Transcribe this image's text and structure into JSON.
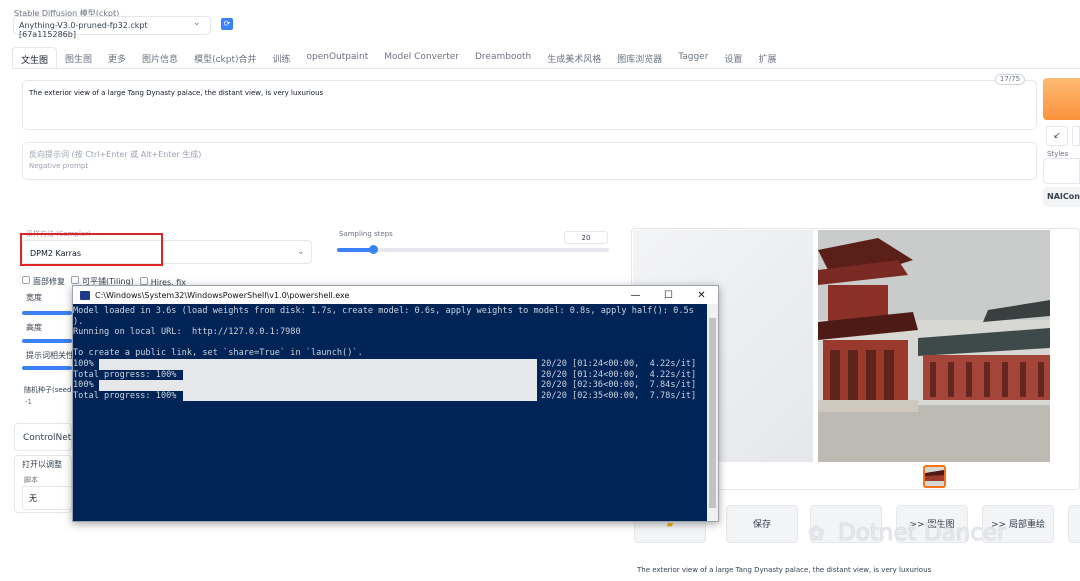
{
  "checkpoint": {
    "label": "Stable Diffusion 模型(ckpt)",
    "value": "Anything-V3.0-pruned-fp32.ckpt [67a115286b]",
    "refresh_icon": "refresh-icon"
  },
  "tabs": [
    "文生图",
    "图生图",
    "更多",
    "图片信息",
    "模型(ckpt)合并",
    "训练",
    "openOutpaint",
    "Model Converter",
    "Dreambooth",
    "生成美术风格",
    "图库浏览器",
    "Tagger",
    "设置",
    "扩展"
  ],
  "prompt": {
    "text": "The exterior view of a large Tang Dynasty palace, the distant view, is very luxurious",
    "counter": "17/75"
  },
  "negative_prompt": {
    "label": "反向提示词 (按 Ctrl+Enter 或 Alt+Enter 生成)",
    "placeholder": "Negative prompt"
  },
  "right_panel": {
    "styles_label": "Styles",
    "tool_glyph": "↙",
    "nai_label": "NAIConv"
  },
  "sampler": {
    "label": "采样方法 (Sampler)",
    "value": "DPM2 Karras"
  },
  "steps": {
    "label": "Sampling steps",
    "value": "20",
    "fraction": 0.133
  },
  "checkboxes": [
    "面部修复",
    "可平铺(Tiling)",
    "Hires. fix"
  ],
  "left_labels": {
    "width": "宽度",
    "height": "高度",
    "prompt_rel": "提示词相关性",
    "seed": "随机种子(seed)",
    "seed_value": "-1",
    "controlnet": "ControlNet",
    "open_adjust": "打开以调整",
    "script": "脚本",
    "script_value": "无"
  },
  "terminal": {
    "title": "C:\\Windows\\System32\\WindowsPowerShell\\v1.0\\powershell.exe",
    "lines": [
      "Model loaded in 3.6s (load weights from disk: 1.7s, create model: 0.6s, apply weights to model: 0.8s, apply half(): 0.5s",
      ").",
      "Running on local URL:  http://127.0.0.1:7980",
      "",
      "To create a public link, set `share=True` in `launch()`.",
      "100%",
      "Total progress: 100%",
      "100%",
      "Total progress: 100%"
    ],
    "progress_right": [
      "20/20 [01:24<00:00,  4.22s/it]",
      "20/20 [01:24<00:00,  4.22s/it]",
      "20/20 [02:36<00:00,  7.84s/it]",
      "20/20 [02:35<00:00,  7.78s/it]"
    ],
    "controls": [
      "—",
      "☐",
      "✕"
    ]
  },
  "actions": {
    "folder_icon": "folder-icon",
    "save": "保存",
    "zip": "",
    "to_img2img": ">> 图生图",
    "to_inpaint": ">> 局部重绘"
  },
  "info": {
    "text": "The exterior view of a large Tang Dynasty palace, the distant view, is very luxurious"
  },
  "watermark": "Dotnet Dancer",
  "colors": {
    "accent": "#3b82f6",
    "generate": "#fb923c",
    "terminal_bg": "#012456",
    "highlight_box": "#dc2626"
  }
}
